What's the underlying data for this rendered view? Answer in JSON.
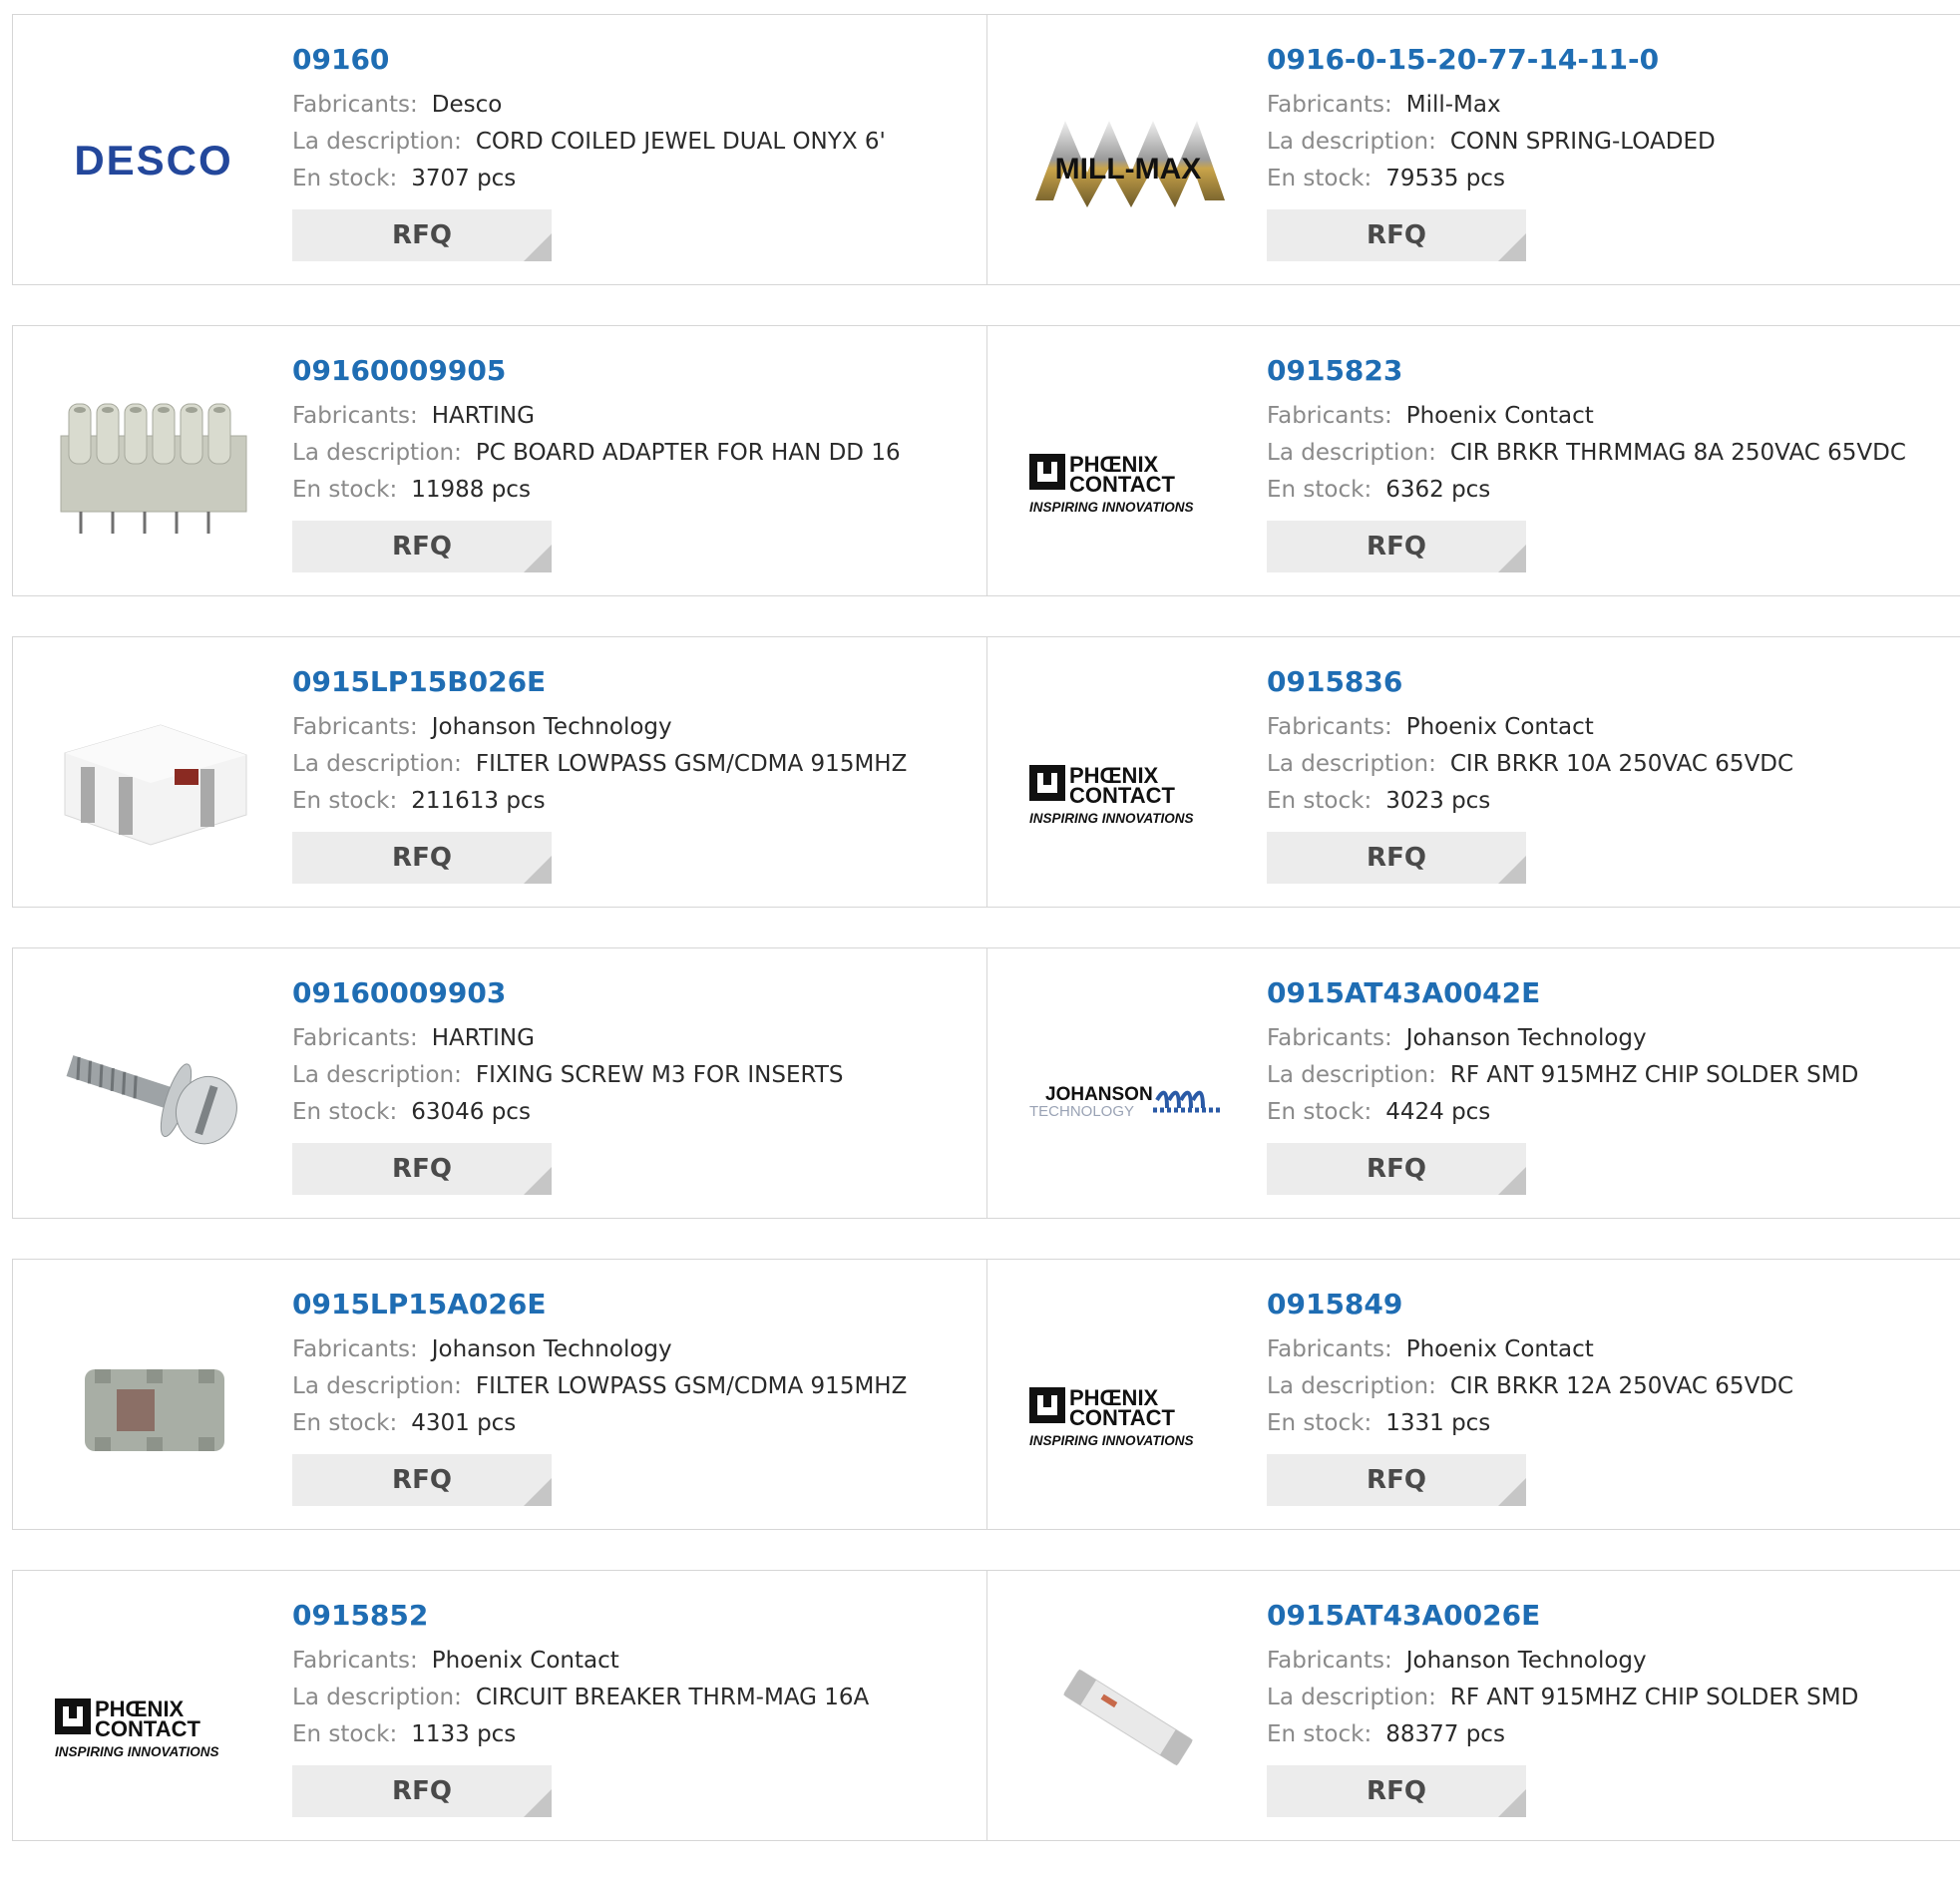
{
  "labels": {
    "manufacturer": "Fabricants:",
    "description": "La description:",
    "stock": "En stock:",
    "rfq": "RFQ"
  },
  "products": [
    {
      "part": "09160",
      "manufacturer": "Desco",
      "description": "CORD COILED JEWEL DUAL ONYX 6'",
      "stock": "3707 pcs",
      "image": "desco-logo"
    },
    {
      "part": "0916-0-15-20-77-14-11-0",
      "manufacturer": "Mill-Max",
      "description": "CONN SPRING-LOADED",
      "stock": "79535 pcs",
      "image": "millmax-logo"
    },
    {
      "part": "09160009905",
      "manufacturer": "HARTING",
      "description": "PC BOARD ADAPTER FOR HAN DD 16",
      "stock": "11988 pcs",
      "image": "connector-adapter-photo"
    },
    {
      "part": "0915823",
      "manufacturer": "Phoenix Contact",
      "description": "CIR BRKR THRMMAG 8A 250VAC 65VDC",
      "stock": "6362 pcs",
      "image": "phoenix-logo"
    },
    {
      "part": "0915LP15B026E",
      "manufacturer": "Johanson Technology",
      "description": "FILTER LOWPASS GSM/CDMA 915MHZ",
      "stock": "211613 pcs",
      "image": "chip-filter-photo"
    },
    {
      "part": "0915836",
      "manufacturer": "Phoenix Contact",
      "description": "CIR BRKR 10A 250VAC 65VDC",
      "stock": "3023 pcs",
      "image": "phoenix-logo"
    },
    {
      "part": "09160009903",
      "manufacturer": "HARTING",
      "description": "FIXING SCREW M3 FOR INSERTS",
      "stock": "63046 pcs",
      "image": "screw-photo"
    },
    {
      "part": "0915AT43A0042E",
      "manufacturer": "Johanson Technology",
      "description": "RF ANT 915MHZ CHIP SOLDER SMD",
      "stock": "4424 pcs",
      "image": "johanson-logo"
    },
    {
      "part": "0915LP15A026E",
      "manufacturer": "Johanson Technology",
      "description": "FILTER LOWPASS GSM/CDMA 915MHZ",
      "stock": "4301 pcs",
      "image": "small-chip-photo"
    },
    {
      "part": "0915849",
      "manufacturer": "Phoenix Contact",
      "description": "CIR BRKR 12A 250VAC 65VDC",
      "stock": "1331 pcs",
      "image": "phoenix-logo"
    },
    {
      "part": "0915852",
      "manufacturer": "Phoenix Contact",
      "description": "CIRCUIT BREAKER THRM-MAG 16A",
      "stock": "1133 pcs",
      "image": "phoenix-logo"
    },
    {
      "part": "0915AT43A0026E",
      "manufacturer": "Johanson Technology",
      "description": "RF ANT 915MHZ CHIP SOLDER SMD",
      "stock": "88377 pcs",
      "image": "antenna-chip-photo"
    }
  ],
  "logo_text": {
    "desco": "DESCO",
    "millmax": "MILL-MAX",
    "phoenix_line1": "PHŒNIX",
    "phoenix_line2": "CONTACT",
    "phoenix_tagline": "INSPIRING INNOVATIONS",
    "johanson_line1": "JOHANSON",
    "johanson_line2": "TECHNOLOGY"
  },
  "colors": {
    "part_link": "#1f6db3",
    "label": "#8a8a8a",
    "value": "#2a2a2a",
    "rfq_bg": "#ececec",
    "border": "#d6d6d6",
    "desco_blue": "#23479b"
  }
}
